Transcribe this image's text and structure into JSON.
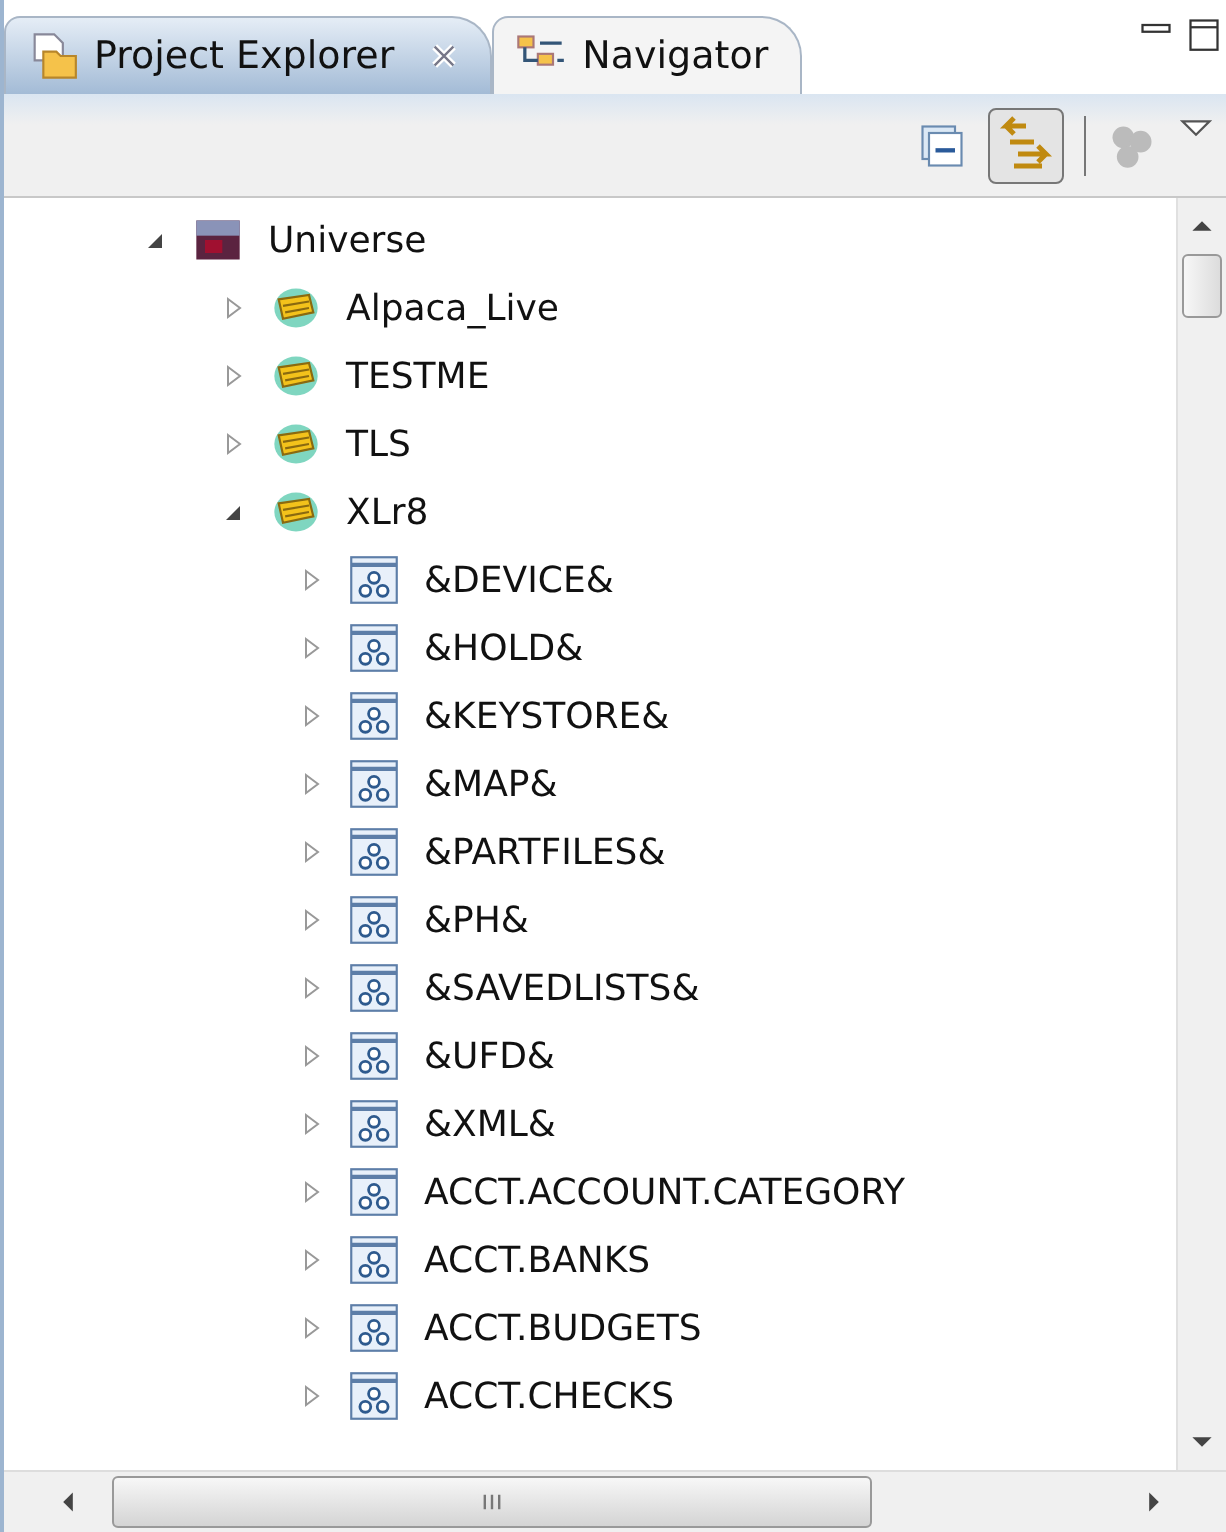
{
  "tabs": [
    {
      "label": "Project Explorer",
      "selected": true
    },
    {
      "label": "Navigator",
      "selected": false
    }
  ],
  "toolbar": {
    "link_with_editor_on": true,
    "filter_disabled": true
  },
  "tree": [
    {
      "label": "Universe",
      "kind": "root",
      "expanded": true,
      "children": [
        {
          "label": "Alpaca_Live",
          "kind": "account",
          "expanded": false
        },
        {
          "label": "TESTME",
          "kind": "account",
          "expanded": false
        },
        {
          "label": "TLS",
          "kind": "account",
          "expanded": false
        },
        {
          "label": "XLr8",
          "kind": "account",
          "expanded": true,
          "children": [
            {
              "label": "&DEVICE&",
              "kind": "file",
              "expanded": false
            },
            {
              "label": "&HOLD&",
              "kind": "file",
              "expanded": false
            },
            {
              "label": "&KEYSTORE&",
              "kind": "file",
              "expanded": false
            },
            {
              "label": "&MAP&",
              "kind": "file",
              "expanded": false
            },
            {
              "label": "&PARTFILES&",
              "kind": "file",
              "expanded": false
            },
            {
              "label": "&PH&",
              "kind": "file",
              "expanded": false
            },
            {
              "label": "&SAVEDLISTS&",
              "kind": "file",
              "expanded": false
            },
            {
              "label": "&UFD&",
              "kind": "file",
              "expanded": false
            },
            {
              "label": "&XML&",
              "kind": "file",
              "expanded": false
            },
            {
              "label": "ACCT.ACCOUNT.CATEGORY",
              "kind": "file",
              "expanded": false
            },
            {
              "label": "ACCT.BANKS",
              "kind": "file",
              "expanded": false
            },
            {
              "label": "ACCT.BUDGETS",
              "kind": "file",
              "expanded": false
            },
            {
              "label": "ACCT.CHECKS",
              "kind": "file",
              "expanded": false
            }
          ]
        }
      ]
    }
  ]
}
